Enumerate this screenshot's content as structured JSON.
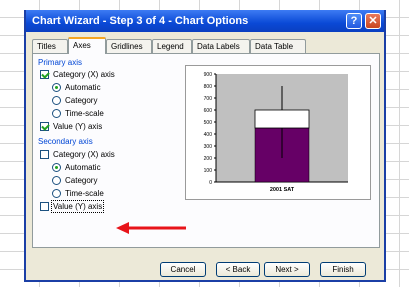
{
  "dialog": {
    "title": "Chart Wizard - Step 3 of 4 - Chart Options",
    "help_label": "?",
    "close_label": "✕"
  },
  "tabs": [
    "Titles",
    "Axes",
    "Gridlines",
    "Legend",
    "Data Labels",
    "Data Table"
  ],
  "active_tab": "Axes",
  "primary_axis": {
    "label": "Primary axis",
    "category_label": "Category (X) axis",
    "category_checked": true,
    "options": [
      "Automatic",
      "Category",
      "Time-scale"
    ],
    "selected_option": "Automatic",
    "value_label": "Value (Y) axis",
    "value_checked": true
  },
  "secondary_axis": {
    "label": "Secondary axis",
    "category_label": "Category (X) axis",
    "category_checked": false,
    "options": [
      "Automatic",
      "Category",
      "Time-scale"
    ],
    "selected_option": "Automatic",
    "value_label": "Value (Y) axis",
    "value_checked": false
  },
  "chart_data": {
    "type": "bar",
    "categories": [
      "2001 SAT"
    ],
    "values": [
      450
    ],
    "box_range": [
      450,
      600
    ],
    "whisker_range": [
      200,
      800
    ],
    "yticks": [
      "900",
      "800",
      "700",
      "600",
      "500",
      "400",
      "300",
      "200",
      "100",
      "0"
    ],
    "ylim": [
      0,
      900
    ],
    "bar_color": "#660066",
    "plot_bg": "#c0c0c0"
  },
  "buttons": {
    "cancel": "Cancel",
    "back": "< Back",
    "next": "Next >",
    "finish": "Finish"
  },
  "colors": {
    "annotation_arrow": "#e8141a",
    "title_bar": "#0a49d6"
  }
}
